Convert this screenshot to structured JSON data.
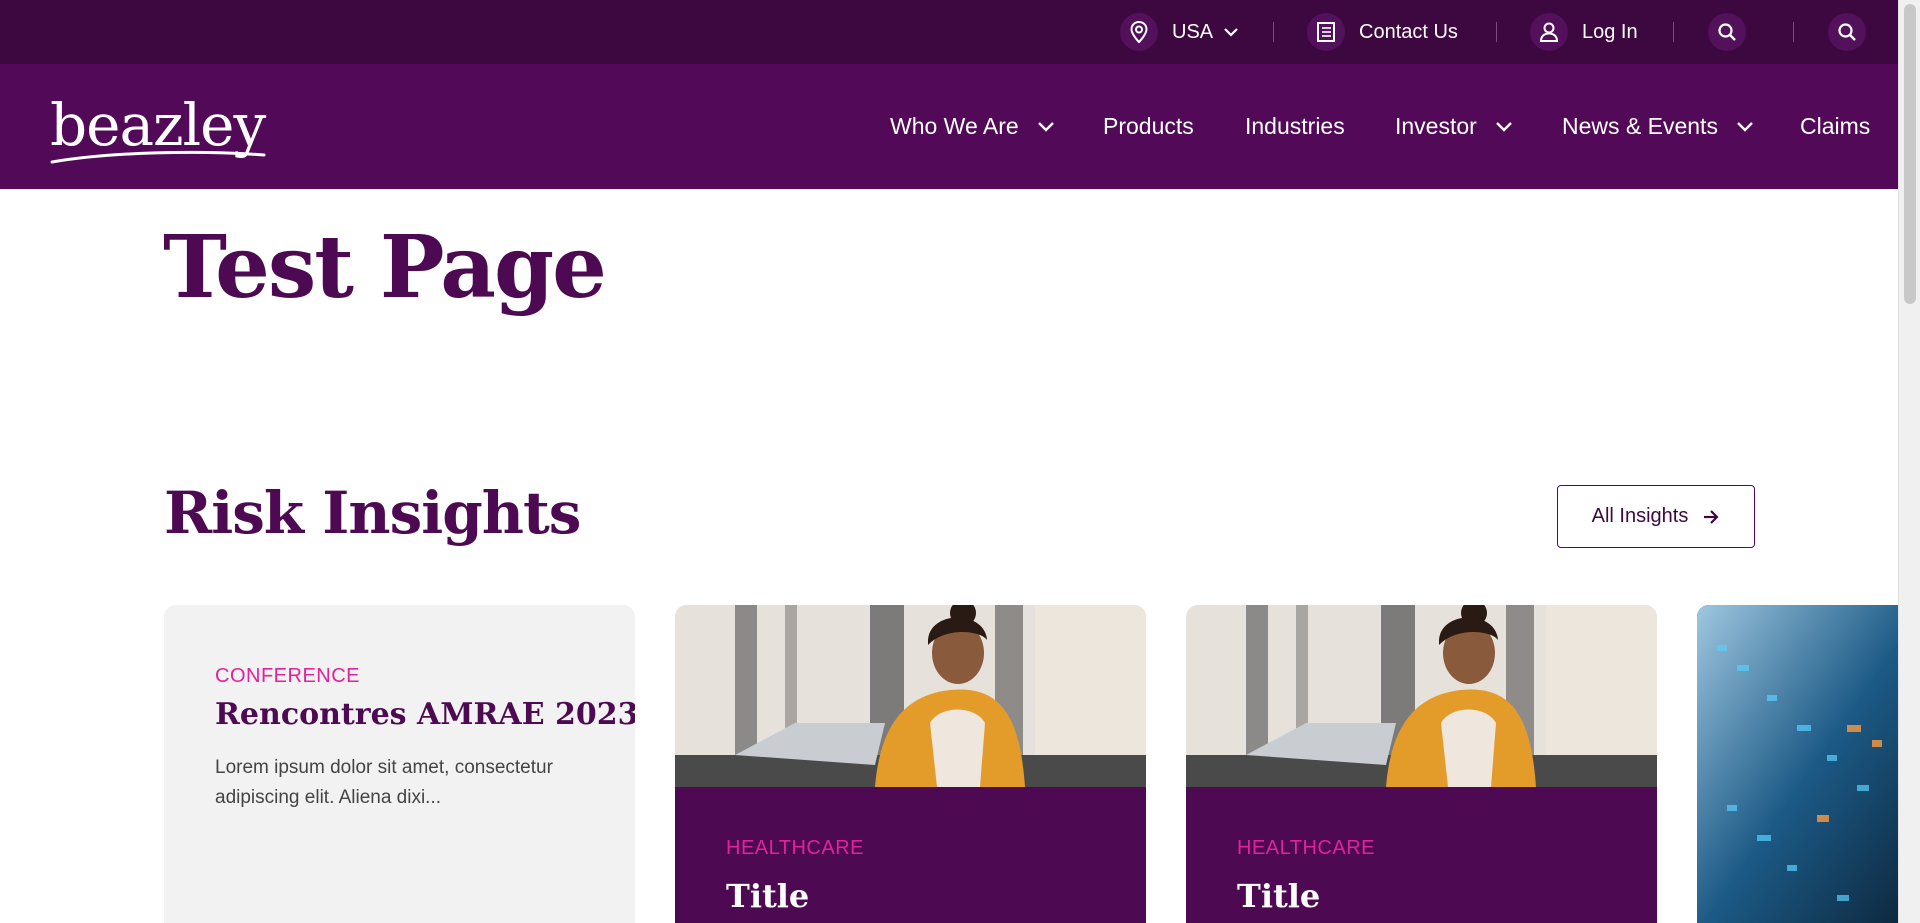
{
  "utility": {
    "country": "USA",
    "contact": "Contact Us",
    "login": "Log In",
    "icons": [
      "location-pin-icon",
      "chevron-down-icon",
      "contact-list-icon",
      "user-icon",
      "search-icon"
    ]
  },
  "nav": {
    "logo_text": "beazley",
    "items": [
      {
        "label": "Who We Are",
        "has_dropdown": true
      },
      {
        "label": "Products",
        "has_dropdown": false
      },
      {
        "label": "Industries",
        "has_dropdown": false
      },
      {
        "label": "Investor",
        "has_dropdown": true
      },
      {
        "label": "News & Events",
        "has_dropdown": true
      },
      {
        "label": "Claims",
        "has_dropdown": false
      }
    ]
  },
  "page": {
    "title": "Test Page"
  },
  "insights": {
    "heading": "Risk Insights",
    "all_button": "All Insights",
    "cards": [
      {
        "kicker": "CONFERENCE",
        "title": "Rencontres AMRAE 2023",
        "description": "Lorem ipsum dolor sit amet, consectetur adipiscing elit. Aliena dixi..."
      },
      {
        "kicker": "HEALTHCARE",
        "title": "Title"
      },
      {
        "kicker": "HEALTHCARE",
        "title": "Title"
      }
    ]
  },
  "colors": {
    "utility_bar": "#3d0840",
    "nav_bar": "#520a58",
    "heading": "#4d0a52",
    "kicker": "#e0239b",
    "card_grey": "#f2f2f2"
  }
}
